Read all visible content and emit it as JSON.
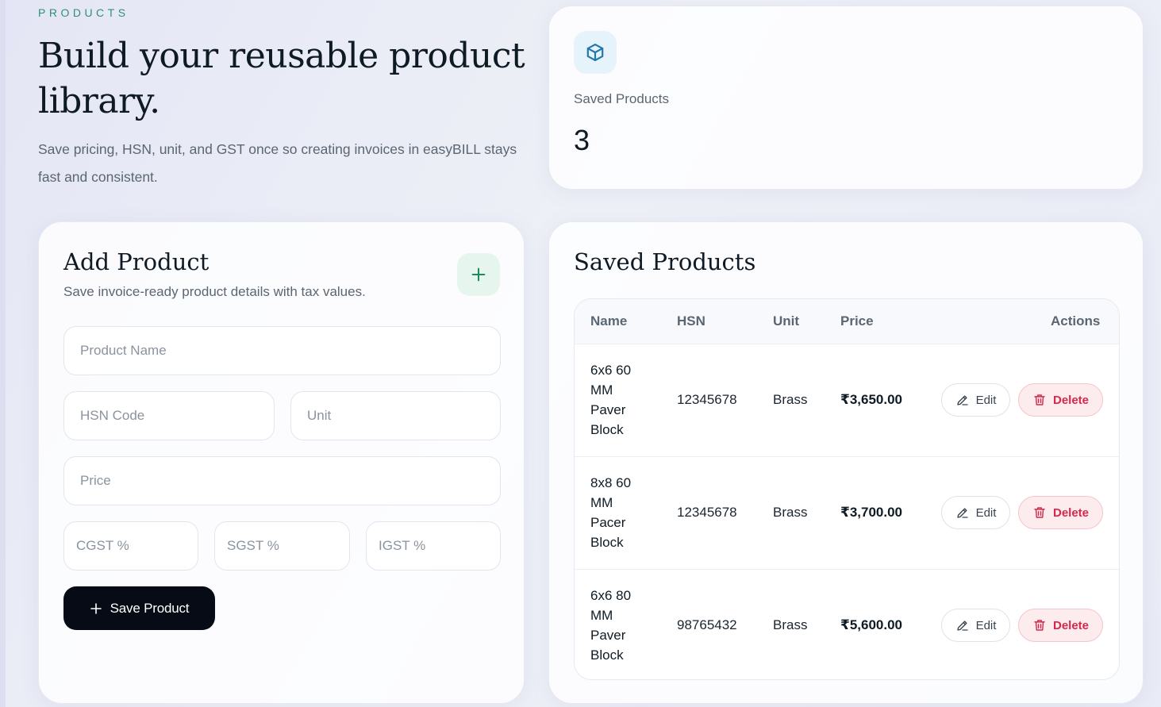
{
  "header": {
    "eyebrow": "PRODUCTS",
    "title": "Build your reusable product library.",
    "description": "Save pricing, HSN, unit, and GST once so creating invoices in easyBILL stays fast and consistent."
  },
  "stat": {
    "icon": "box-icon",
    "label": "Saved Products",
    "value": "3"
  },
  "form": {
    "title": "Add Product",
    "subtitle": "Save invoice-ready product details with tax values.",
    "fields": {
      "product_name": {
        "placeholder": "Product Name",
        "value": ""
      },
      "hsn": {
        "placeholder": "HSN Code",
        "value": ""
      },
      "unit": {
        "placeholder": "Unit",
        "value": ""
      },
      "price": {
        "placeholder": "Price",
        "value": ""
      },
      "cgst": {
        "placeholder": "CGST %",
        "value": ""
      },
      "sgst": {
        "placeholder": "SGST %",
        "value": ""
      },
      "igst": {
        "placeholder": "IGST %",
        "value": ""
      }
    },
    "save_label": "Save Product"
  },
  "list": {
    "title": "Saved Products",
    "columns": {
      "name": "Name",
      "hsn": "HSN",
      "unit": "Unit",
      "price": "Price",
      "actions": "Actions"
    },
    "rows": [
      {
        "name": "6x6 60 MM Paver Block",
        "hsn": "12345678",
        "unit": "Brass",
        "price": "₹3,650.00",
        "edit": "Edit",
        "delete": "Delete"
      },
      {
        "name": "8x8 60 MM Pacer Block",
        "hsn": "12345678",
        "unit": "Brass",
        "price": "₹3,700.00",
        "edit": "Edit",
        "delete": "Delete"
      },
      {
        "name": "6x6 80 MM Paver Block",
        "hsn": "98765432",
        "unit": "Brass",
        "price": "₹5,600.00",
        "edit": "Edit",
        "delete": "Delete"
      }
    ]
  },
  "colors": {
    "accent_teal": "#2f8f7e",
    "primary_dark": "#070b16",
    "danger": "#d6284b",
    "icon_blue": "#1f79ad",
    "icon_green": "#1e8a5a"
  }
}
